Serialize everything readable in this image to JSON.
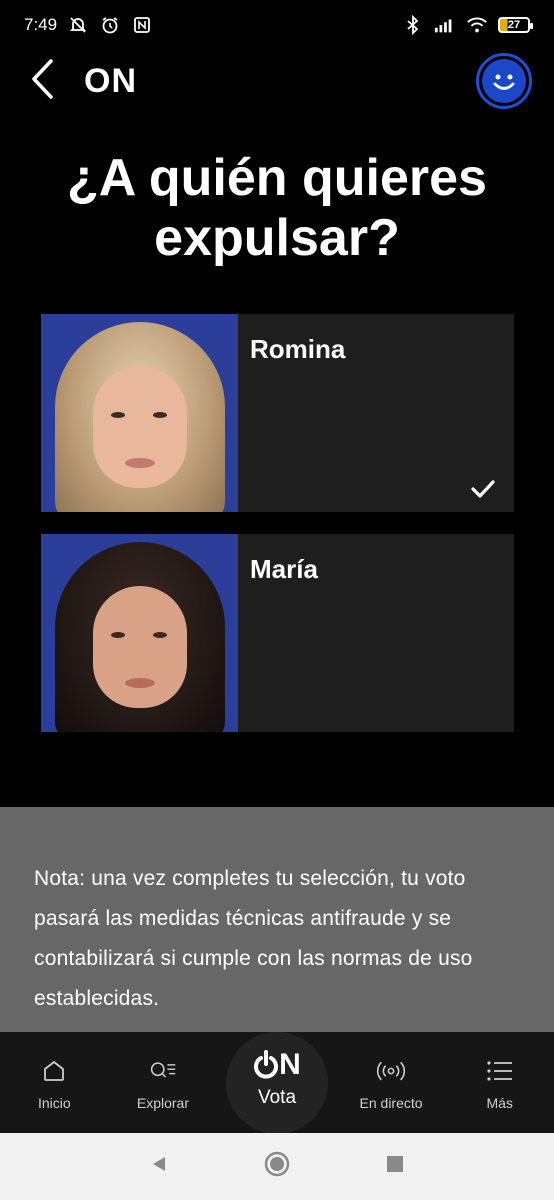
{
  "status_bar": {
    "time": "7:49",
    "battery": "27",
    "icons": [
      "muted-bell-icon",
      "alarm-icon",
      "nfc-icon",
      "bluetooth-icon",
      "signal-icon",
      "wifi-icon",
      "battery-icon"
    ]
  },
  "header": {
    "logo": "ON",
    "back_icon": "chevron-left-icon",
    "avatar_icon": "smiley-face-icon"
  },
  "title": "¿A quién quieres expulsar?",
  "candidates": [
    {
      "name": "Romina",
      "selected": true,
      "photo_colors": {
        "hair": "#cdb89a",
        "face": "#e8b79c"
      }
    },
    {
      "name": "María",
      "selected": false,
      "photo_colors": {
        "hair": "#1e1512",
        "face": "#d9a287"
      }
    }
  ],
  "note": "Nota: una vez completes tu selección, tu voto pasará las medidas técnicas antifraude y se contabilizará si cumple con las normas de uso establecidas.",
  "bottom_nav": {
    "items": [
      {
        "label": "Inicio",
        "icon": "home-icon"
      },
      {
        "label": "Explorar",
        "icon": "search-list-icon"
      },
      {
        "label": "En directo",
        "icon": "live-broadcast-icon"
      },
      {
        "label": "Más",
        "icon": "menu-icon"
      }
    ],
    "center": {
      "logo": "ON",
      "label": "Vota",
      "icon": "power-on-icon"
    }
  },
  "system_nav": [
    "back-triangle-icon",
    "home-circle-icon",
    "recents-square-icon"
  ],
  "colors": {
    "accent_blue": "#1c47c9",
    "card_bg": "#1e1e1e",
    "note_bg": "#676767",
    "photo_bg": "#2b3f9a",
    "photo_arc": "#f0b400"
  }
}
